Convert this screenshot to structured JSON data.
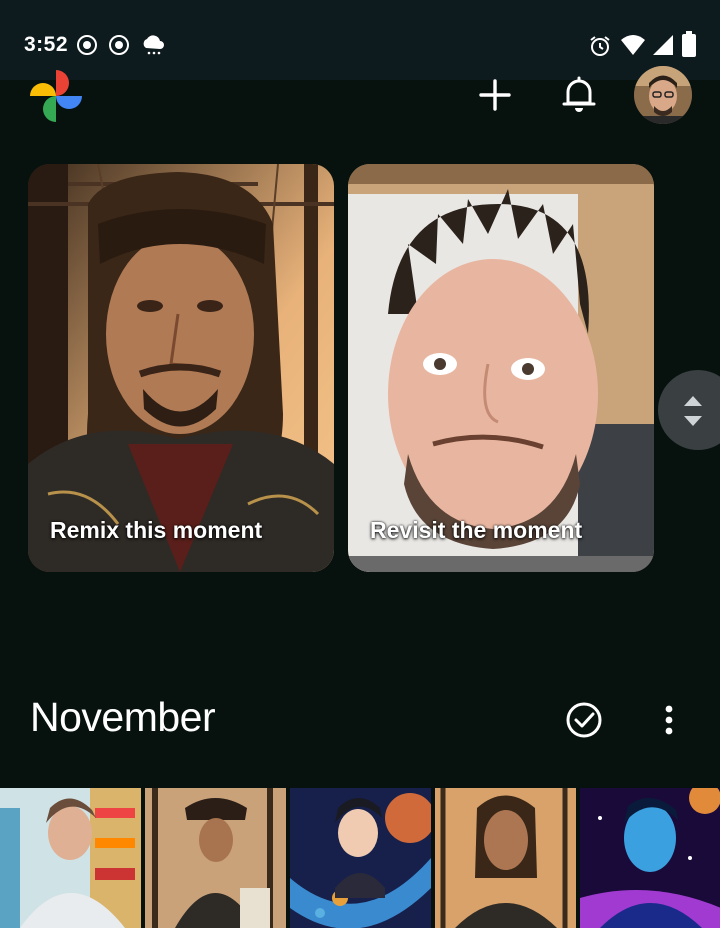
{
  "status_bar": {
    "time": "3:52",
    "left_icons": [
      "notification-badge-icon",
      "notification-badge-icon",
      "weather-cloud-icon"
    ],
    "right_icons": [
      "alarm-icon",
      "wifi-icon",
      "signal-icon",
      "battery-icon"
    ]
  },
  "app_bar": {
    "logo": "google-photos-logo",
    "actions": [
      "add-icon",
      "notifications-bell-icon",
      "account-avatar"
    ]
  },
  "memories": [
    {
      "label": "Remix this moment",
      "image": "pirate-portrait"
    },
    {
      "label": "Revisit the moment",
      "image": "selfie-portrait"
    }
  ],
  "section": {
    "title": "November",
    "actions": [
      "select-check-icon",
      "more-vert-icon"
    ]
  },
  "thumbnails": [
    "grocery-store-man",
    "pirate-ship-man",
    "space-cartoon-man",
    "pirate-portrait",
    "blue-cosmic-man"
  ],
  "colors": {
    "background": "#07120f",
    "status_bar": "#0d1a1e",
    "text": "#ffffff"
  }
}
